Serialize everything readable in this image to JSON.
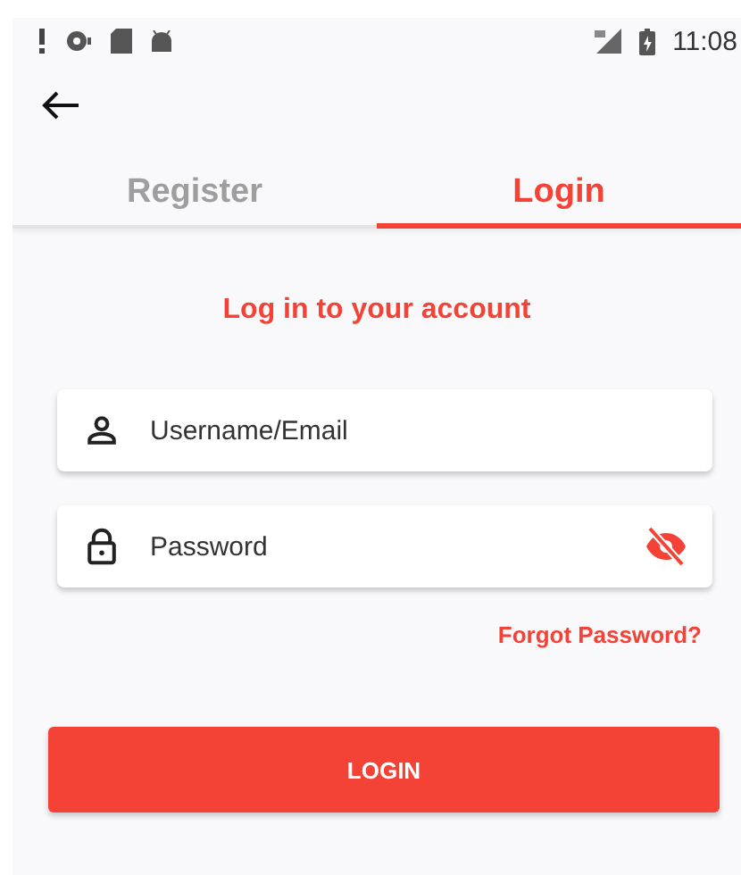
{
  "status_bar": {
    "time": "11:08"
  },
  "tabs": [
    {
      "label": "Register",
      "selected": false
    },
    {
      "label": "Login",
      "selected": true
    }
  ],
  "heading": "Log in to your account",
  "fields": [
    {
      "kind": "username",
      "placeholder": "Username/Email"
    },
    {
      "kind": "password",
      "placeholder": "Password",
      "password_hidden": true
    }
  ],
  "forgot_link": "Forgot Password?",
  "login_button": "LOGIN"
}
